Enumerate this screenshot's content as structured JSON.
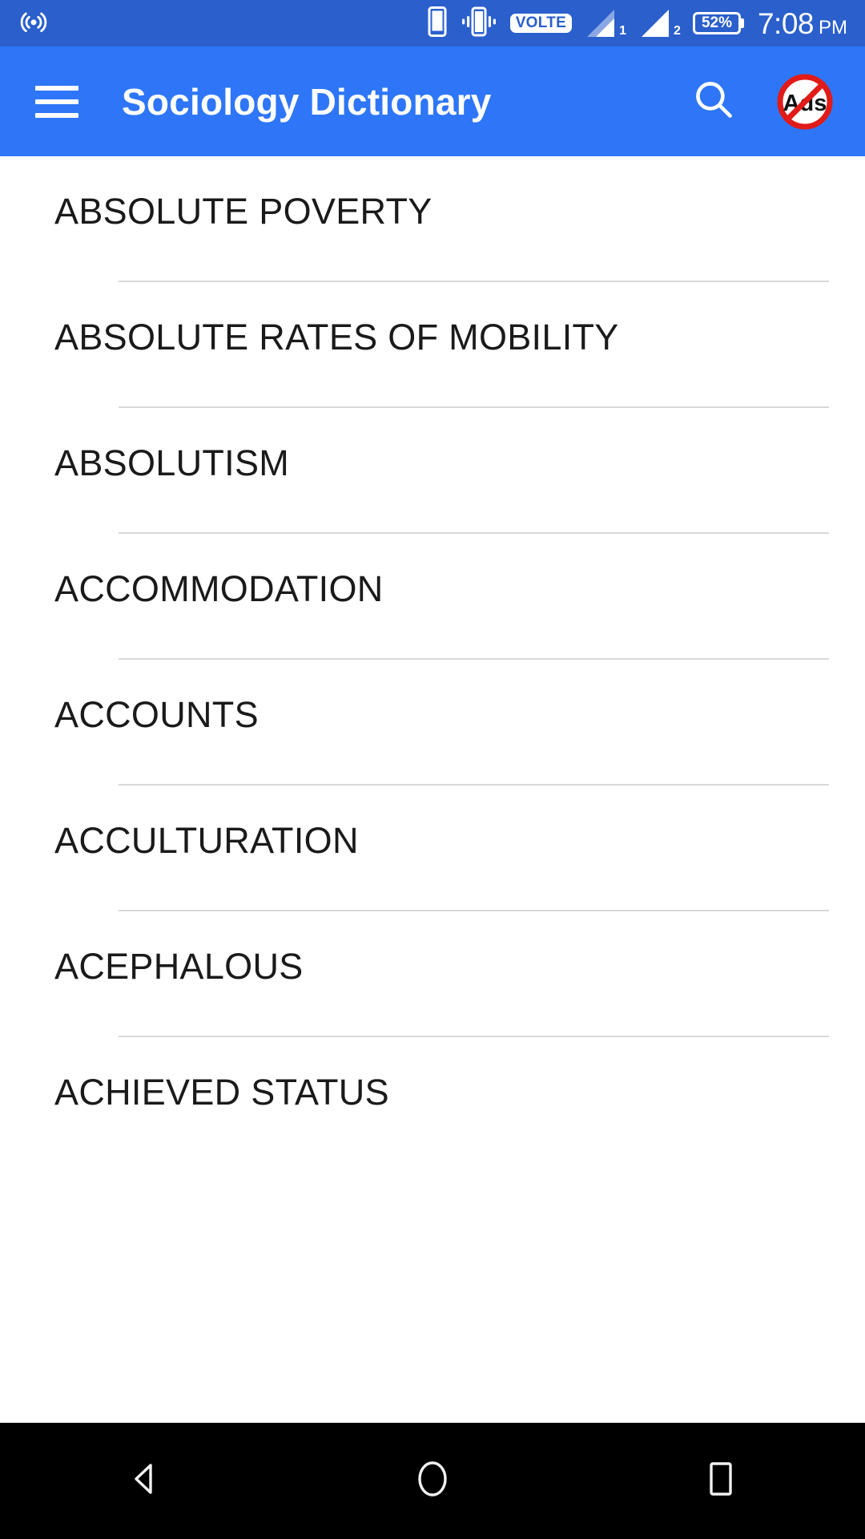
{
  "status_bar": {
    "background_color": "#2A5FCC",
    "left_icons": [
      {
        "name": "hotspot-icon",
        "label": "hotspot"
      }
    ],
    "right_icons": [
      {
        "name": "sim-card-icon",
        "label": "phone"
      },
      {
        "name": "vibrate-icon",
        "label": "vibrate"
      }
    ],
    "volte_label": "VOLTE",
    "signal_1_label": "1",
    "signal_2_label": "2",
    "battery_percent": "52%",
    "time": "7:08",
    "am_pm": "PM"
  },
  "app_bar": {
    "background_color": "#2E76F7",
    "title": "Sociology Dictionary",
    "menu_icon": "hamburger-menu-icon",
    "search_icon": "search-icon",
    "no_ads_icon": "no-ads-icon",
    "no_ads_label": "Ads"
  },
  "list": {
    "items": [
      {
        "word": "ABSOLUTE POVERTY",
        "divider": true
      },
      {
        "word": "ABSOLUTE RATES OF MOBILITY",
        "divider": true
      },
      {
        "word": "ABSOLUTISM",
        "divider": true
      },
      {
        "word": "ACCOMMODATION",
        "divider": true
      },
      {
        "word": "ACCOUNTS",
        "divider": true
      },
      {
        "word": "ACCULTURATION",
        "divider": true
      },
      {
        "word": "ACEPHALOUS",
        "divider": true
      },
      {
        "word": "ACHIEVED STATUS",
        "divider": false
      }
    ]
  },
  "nav_bar": {
    "background_color": "#000000",
    "buttons": [
      {
        "name": "back-button",
        "icon": "back-triangle-icon"
      },
      {
        "name": "home-button",
        "icon": "home-circle-icon"
      },
      {
        "name": "recents-button",
        "icon": "recents-square-icon"
      }
    ]
  }
}
